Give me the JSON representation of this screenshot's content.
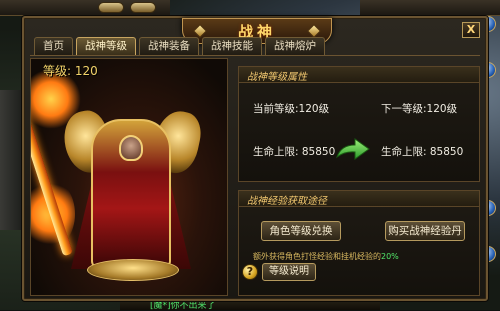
{
  "dialog": {
    "title": "战神",
    "close_label": "X"
  },
  "tabs": [
    {
      "label": "首页"
    },
    {
      "label": "战神等级"
    },
    {
      "label": "战神装备"
    },
    {
      "label": "战神技能"
    },
    {
      "label": "战神熔炉"
    }
  ],
  "active_tab": "战神等级",
  "character": {
    "level_text": "等级: 120"
  },
  "level_info": {
    "header": "战神等级属性",
    "current_level": "当前等级:120级",
    "next_level": "下一等级:120级",
    "current_hp": "生命上限: 85850",
    "next_hp": "生命上限: 85850"
  },
  "exp_info": {
    "header": "战神经验获取途径",
    "btn_exchange": "角色等级兑换",
    "btn_buy": "购买战神经验丹",
    "note_prefix": "额外获得角色打怪经验和挂机经验的",
    "note_pct": "20%"
  },
  "help": {
    "label": "等级说明",
    "icon": "?"
  },
  "world": {
    "chat_text": "[魔*]你不出来了"
  }
}
